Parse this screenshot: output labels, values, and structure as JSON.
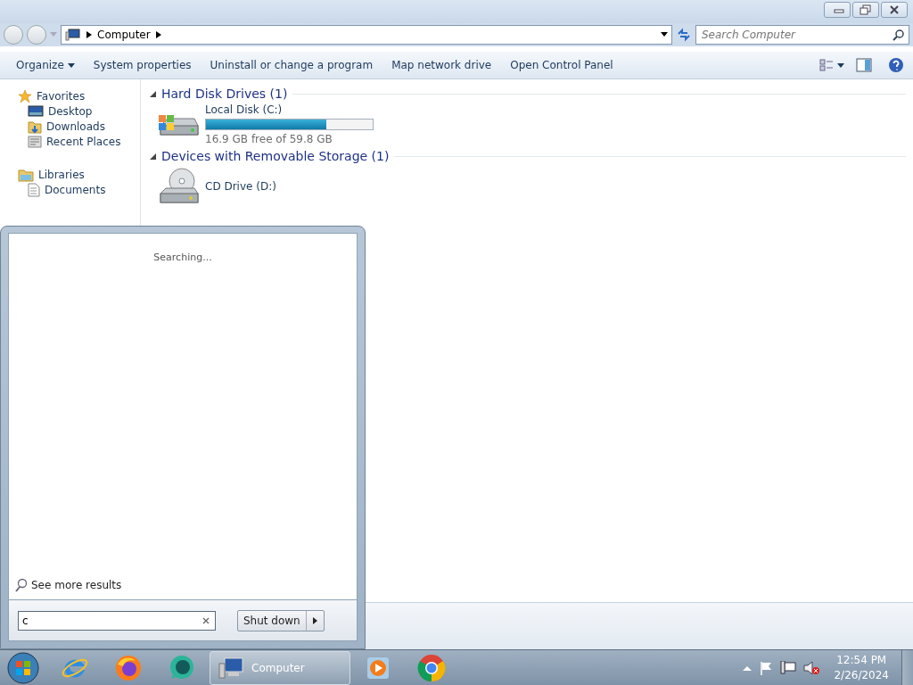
{
  "address_bar": {
    "location": "Computer"
  },
  "search": {
    "placeholder": "Search Computer"
  },
  "toolbar": {
    "items": [
      "Organize",
      "System properties",
      "Uninstall or change a program",
      "Map network drive",
      "Open Control Panel"
    ]
  },
  "sidebar": {
    "groups": [
      {
        "label": "Favorites",
        "items": [
          {
            "label": "Desktop"
          },
          {
            "label": "Downloads"
          },
          {
            "label": "Recent Places"
          }
        ]
      },
      {
        "label": "Libraries",
        "items": [
          {
            "label": "Documents"
          }
        ]
      }
    ]
  },
  "sections": [
    {
      "title": "Hard Disk Drives (1)",
      "expanded": true,
      "drives": [
        {
          "kind": "disk",
          "name": "Local Disk (C:)",
          "level": 0.72,
          "free": "16.9 GB free of 59.8 GB"
        }
      ]
    },
    {
      "title": "Devices with Removable Storage (1)",
      "expanded": true,
      "drives": [
        {
          "kind": "cd",
          "name": "CD Drive (D:)"
        }
      ]
    }
  ],
  "start_menu": {
    "status": "Searching...",
    "see_more": "See more results",
    "search_value": "c",
    "shutdown": "Shut down"
  },
  "taskbar": {
    "window_label": "Computer",
    "time": "12:54 PM",
    "date": "2/26/2024"
  }
}
